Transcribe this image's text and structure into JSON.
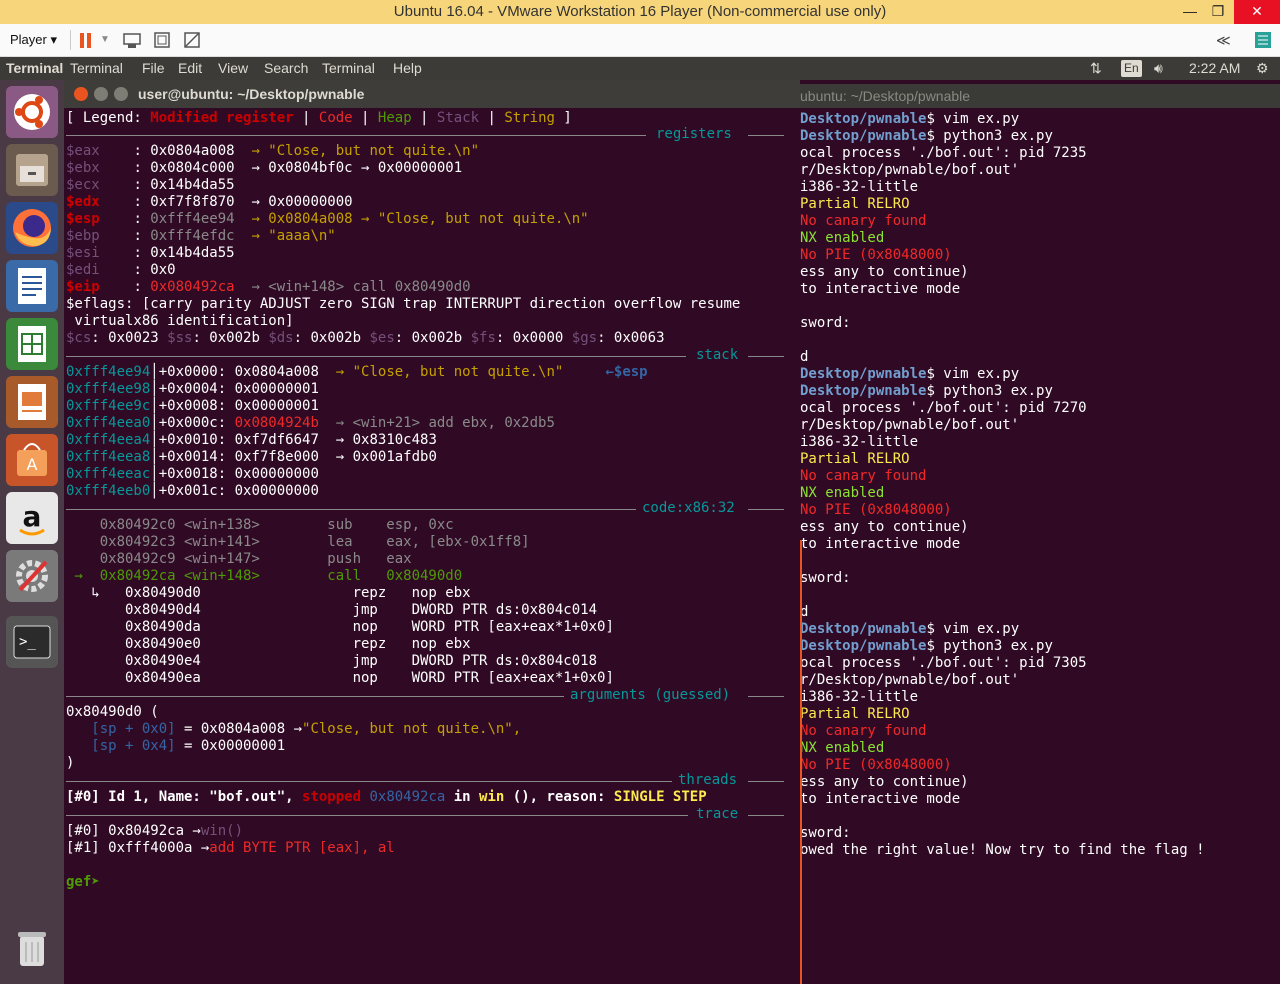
{
  "vmware": {
    "title": "Ubuntu 16.04 - VMware Workstation 16 Player (Non-commercial use only)",
    "player_menu": "Player",
    "collapse_glyph": "≪"
  },
  "topbar": {
    "app_name": "Terminal",
    "menus": [
      "Terminal",
      "File",
      "Edit",
      "View",
      "Search",
      "Terminal",
      "Help"
    ],
    "keyboard": "En",
    "time": "2:22 AM"
  },
  "launcher": {
    "items": [
      "ubuntu-dash-icon",
      "files-icon",
      "firefox-icon",
      "writer-icon",
      "calc-icon",
      "impress-icon",
      "software-center-icon",
      "amazon-icon",
      "settings-icon",
      "terminal-icon",
      "trash-icon"
    ]
  },
  "gef_window": {
    "title": "user@ubuntu: ~/Desktop/pwnable",
    "legend": {
      "prefix": "[ Legend: ",
      "modified": "Modified register",
      "code": "Code",
      "heap": "Heap",
      "stack": "Stack",
      "string": "String",
      "suffix": " ]"
    },
    "sections": {
      "registers": "registers",
      "stack": "stack",
      "code": "code:x86:32",
      "arguments": "arguments (guessed)",
      "threads": "threads",
      "trace": "trace"
    },
    "registers": [
      {
        "name": "$eax",
        "value": "0x0804a008",
        "chain": "→ \"Close, but not quite.\\n\""
      },
      {
        "name": "$ebx",
        "value": "0x0804c000",
        "chain": "→ 0x0804bf0c → 0x00000001"
      },
      {
        "name": "$ecx",
        "value": "0x14b4da55",
        "chain": ""
      },
      {
        "name": "$edx",
        "value": "0xf7f8f870",
        "chain": "→ 0x00000000"
      },
      {
        "name": "$esp",
        "value": "0xfff4ee94",
        "chain": "→ 0x0804a008 → \"Close, but not quite.\\n\""
      },
      {
        "name": "$ebp",
        "value": "0xfff4efdc",
        "chain": "→ \"aaaa\\n\""
      },
      {
        "name": "$esi",
        "value": "0x14b4da55",
        "chain": ""
      },
      {
        "name": "$edi",
        "value": "0x0",
        "chain": ""
      },
      {
        "name": "$eip",
        "value": "0x080492ca",
        "chain": "→ <win+148> call 0x80490d0"
      }
    ],
    "eflags_1": "$eflags: [carry parity ADJUST zero SIGN trap INTERRUPT direction overflow resume",
    "eflags_2": " virtualx86 identification]",
    "segments": "$cs: 0x0023 $ss: 0x002b $ds: 0x002b $es: 0x002b $fs: 0x0000 $gs: 0x0063",
    "stack": [
      {
        "addr": "0xfff4ee94",
        "off": "+0x0000:",
        "val": "0x0804a008",
        "rest": "→ \"Close, but not quite.\\n\"",
        "tag": "←$esp"
      },
      {
        "addr": "0xfff4ee98",
        "off": "+0x0004:",
        "val": "0x00000001",
        "rest": "",
        "tag": ""
      },
      {
        "addr": "0xfff4ee9c",
        "off": "+0x0008:",
        "val": "0x00000001",
        "rest": "",
        "tag": ""
      },
      {
        "addr": "0xfff4eea0",
        "off": "+0x000c:",
        "val": "0x0804924b",
        "rest": "→ <win+21> add ebx, 0x2db5",
        "tag": ""
      },
      {
        "addr": "0xfff4eea4",
        "off": "+0x0010:",
        "val": "0xf7df6647",
        "rest": "→ 0x8310c483",
        "tag": ""
      },
      {
        "addr": "0xfff4eea8",
        "off": "+0x0014:",
        "val": "0xf7f8e000",
        "rest": "→ 0x001afdb0",
        "tag": ""
      },
      {
        "addr": "0xfff4eeac",
        "off": "+0x0018:",
        "val": "0x00000000",
        "rest": "",
        "tag": ""
      },
      {
        "addr": "0xfff4eeb0",
        "off": "+0x001c:",
        "val": "0x00000000",
        "rest": "",
        "tag": ""
      }
    ],
    "code": [
      "    0x80492c0 <win+138>        sub    esp, 0xc",
      "    0x80492c3 <win+141>        lea    eax, [ebx-0x1ff8]",
      "    0x80492c9 <win+147>        push   eax",
      " →  0x80492ca <win+148>        call   0x80490d0",
      "   ↳   0x80490d0                  repz   nop ebx",
      "       0x80490d4                  jmp    DWORD PTR ds:0x804c014",
      "       0x80490da                  nop    WORD PTR [eax+eax*1+0x0]",
      "       0x80490e0                  repz   nop ebx",
      "       0x80490e4                  jmp    DWORD PTR ds:0x804c018",
      "       0x80490ea                  nop    WORD PTR [eax+eax*1+0x0]"
    ],
    "args": {
      "head": "0x80490d0 (",
      "a1_ref": "   [sp + 0x0]",
      "a1_val": " = 0x0804a008 →",
      "a1_str": "\"Close, but not quite.\\n\",",
      "a2_ref": "   [sp + 0x4]",
      "a2_val": " = 0x00000001",
      "tail": ")"
    },
    "thread": {
      "p1": "[#0] Id 1, Name: \"bof.out\", ",
      "stopped": "stopped",
      "addr": " 0x80492ca",
      "in": " in ",
      "fn": "win",
      "p2": " (), reason: ",
      "reason": "SINGLE STEP"
    },
    "trace": [
      {
        "idx": "[#0]",
        "addr": " 0x80492ca →",
        "sym": "win()"
      },
      {
        "idx": "[#1]",
        "addr": " 0xfff4000a →",
        "sym": "add BYTE PTR [eax], al"
      }
    ],
    "prompt": "gef➤"
  },
  "bg_terminal": {
    "title": "ubuntu: ~/Desktop/pwnable",
    "lines": [
      {
        "t": "path",
        "a": "Desktop/pwnable",
        "b": "$ vim ex.py"
      },
      {
        "t": "path",
        "a": "Desktop/pwnable",
        "b": "$ python3 ex.py"
      },
      {
        "t": "plain",
        "a": "ocal process './bof.out': pid 7235"
      },
      {
        "t": "plain",
        "a": "r/Desktop/pwnable/bof.out'"
      },
      {
        "t": "plain",
        "a": "i386-32-little"
      },
      {
        "t": "yellow",
        "a": "Partial RELRO"
      },
      {
        "t": "red",
        "a": "No canary found"
      },
      {
        "t": "green",
        "a": "NX enabled"
      },
      {
        "t": "red",
        "a": "No PIE (0x8048000)"
      },
      {
        "t": "plain",
        "a": "ess any to continue)"
      },
      {
        "t": "plain",
        "a": "to interactive mode"
      },
      {
        "t": "plain",
        "a": ""
      },
      {
        "t": "plain",
        "a": "sword:"
      },
      {
        "t": "plain",
        "a": ""
      },
      {
        "t": "plain",
        "a": "d"
      },
      {
        "t": "path",
        "a": "Desktop/pwnable",
        "b": "$ vim ex.py"
      },
      {
        "t": "path",
        "a": "Desktop/pwnable",
        "b": "$ python3 ex.py"
      },
      {
        "t": "plain",
        "a": "ocal process './bof.out': pid 7270"
      },
      {
        "t": "plain",
        "a": "r/Desktop/pwnable/bof.out'"
      },
      {
        "t": "plain",
        "a": "i386-32-little"
      },
      {
        "t": "yellow",
        "a": "Partial RELRO"
      },
      {
        "t": "red",
        "a": "No canary found"
      },
      {
        "t": "green",
        "a": "NX enabled"
      },
      {
        "t": "red",
        "a": "No PIE (0x8048000)"
      },
      {
        "t": "plain",
        "a": "ess any to continue)"
      },
      {
        "t": "plain",
        "a": "to interactive mode"
      },
      {
        "t": "plain",
        "a": ""
      },
      {
        "t": "plain",
        "a": "sword:"
      },
      {
        "t": "plain",
        "a": ""
      },
      {
        "t": "plain",
        "a": "d"
      },
      {
        "t": "path",
        "a": "Desktop/pwnable",
        "b": "$ vim ex.py"
      },
      {
        "t": "path",
        "a": "Desktop/pwnable",
        "b": "$ python3 ex.py"
      },
      {
        "t": "plain",
        "a": "ocal process './bof.out': pid 7305"
      },
      {
        "t": "plain",
        "a": "r/Desktop/pwnable/bof.out'"
      },
      {
        "t": "plain",
        "a": "i386-32-little"
      },
      {
        "t": "yellow",
        "a": "Partial RELRO"
      },
      {
        "t": "red",
        "a": "No canary found"
      },
      {
        "t": "green",
        "a": "NX enabled"
      },
      {
        "t": "red",
        "a": "No PIE (0x8048000)"
      },
      {
        "t": "plain",
        "a": "ess any to continue)"
      },
      {
        "t": "plain",
        "a": "to interactive mode"
      },
      {
        "t": "plain",
        "a": ""
      },
      {
        "t": "plain",
        "a": "sword:"
      },
      {
        "t": "plain",
        "a": "owed the right value! Now try to find the flag !"
      }
    ]
  },
  "colors": {
    "terminal_bg": "#300a24",
    "vm_title_bg": "#f7d57a",
    "launcher_bg": "#4a3a45",
    "accent_orange": "#e95420"
  }
}
